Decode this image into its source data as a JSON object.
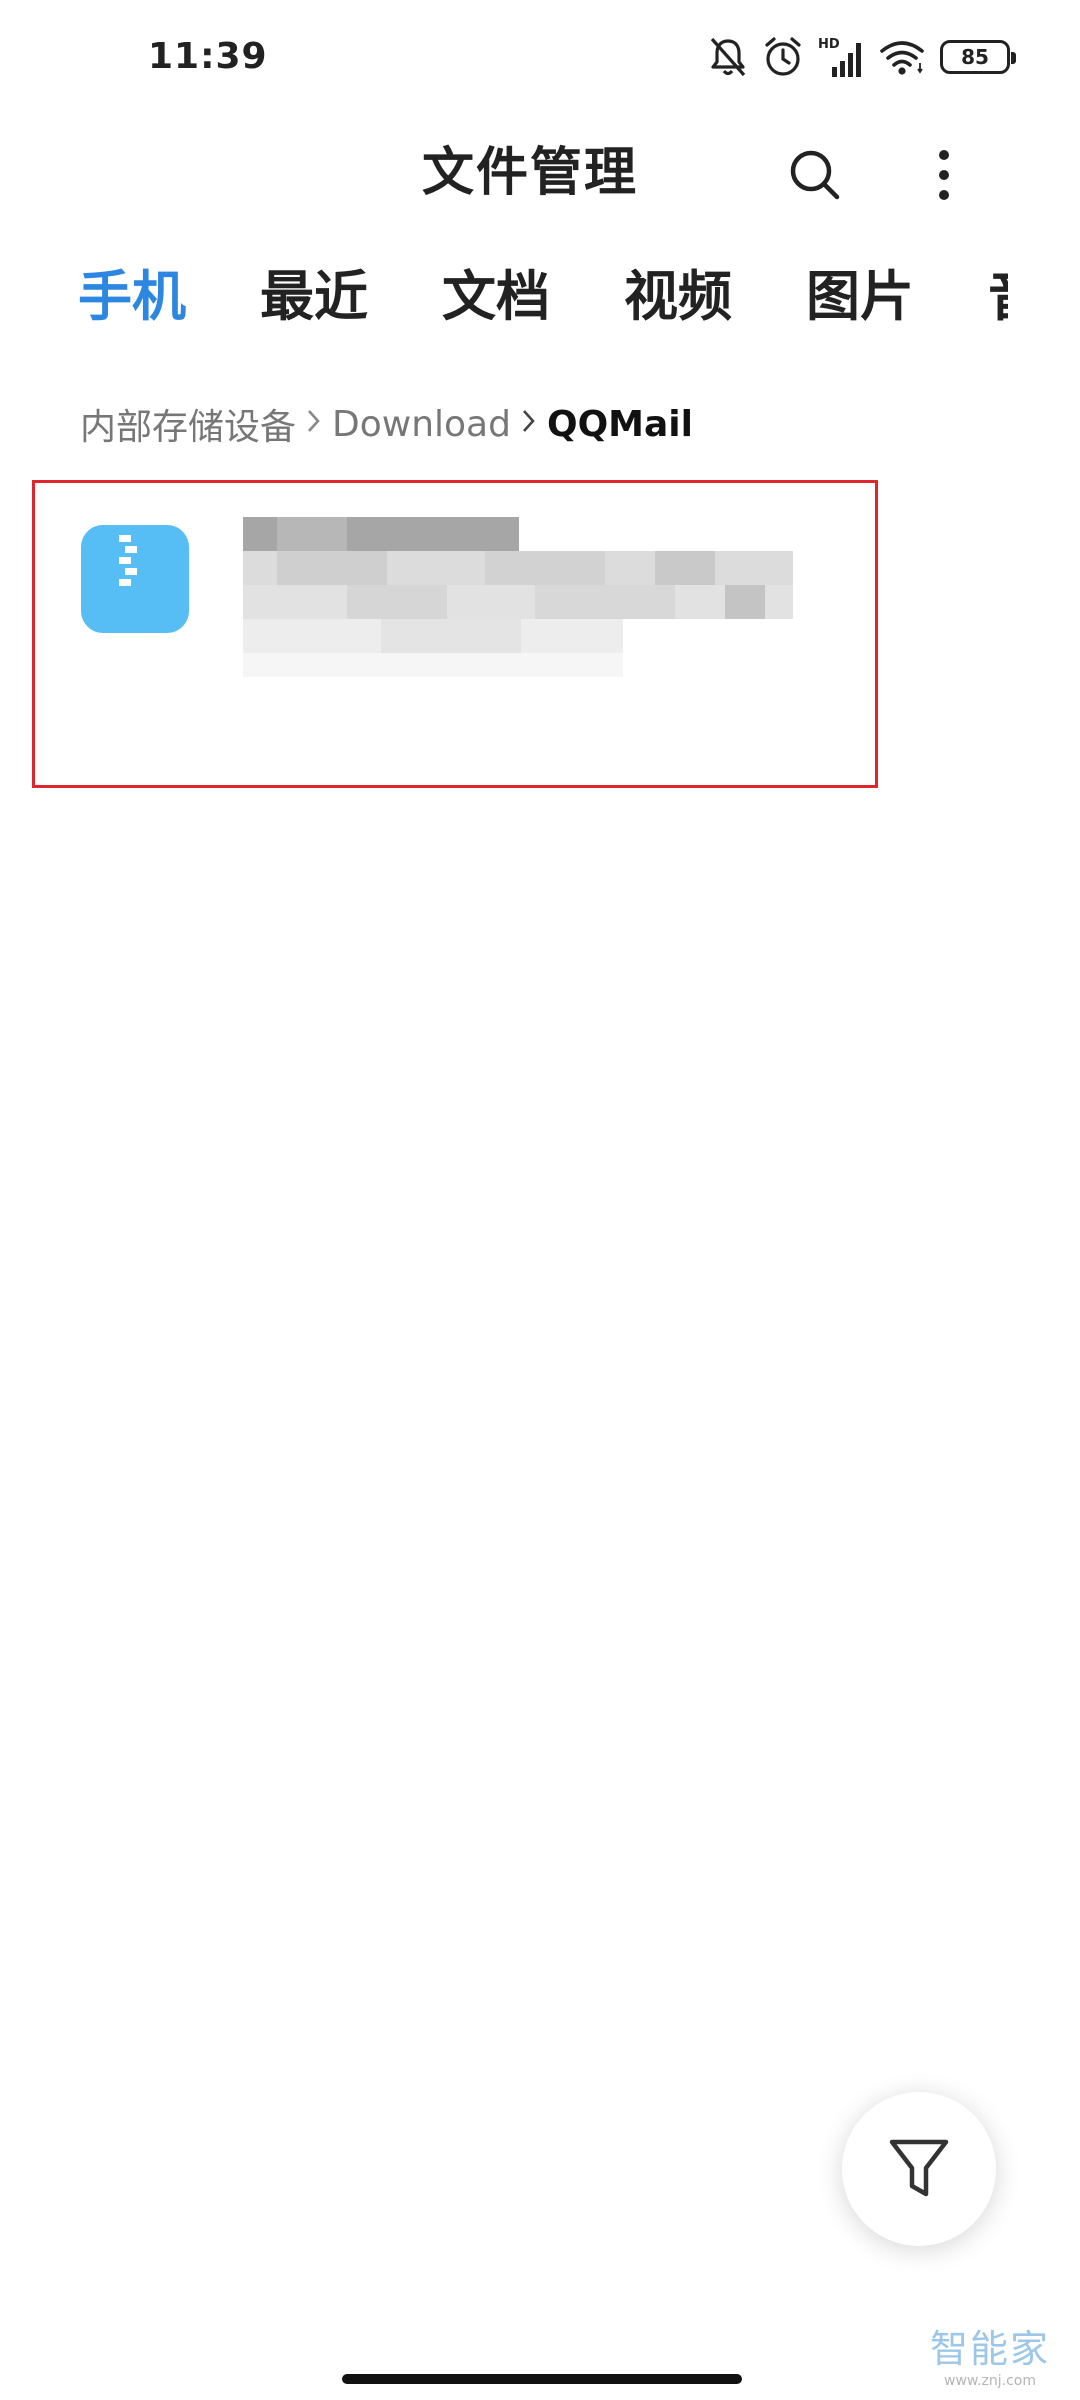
{
  "status_bar": {
    "time": "11:39",
    "battery": "85",
    "network_badge": "HD",
    "icons": [
      "bell-off-icon",
      "alarm-icon",
      "signal-icon",
      "wifi-icon",
      "battery-icon"
    ]
  },
  "header": {
    "title": "文件管理",
    "icons": [
      "search-icon",
      "more-vert-icon"
    ]
  },
  "tabs": [
    {
      "label": "手机",
      "active": true
    },
    {
      "label": "最近",
      "active": false
    },
    {
      "label": "文档",
      "active": false
    },
    {
      "label": "视频",
      "active": false
    },
    {
      "label": "图片",
      "active": false
    },
    {
      "label": "音",
      "active": false
    }
  ],
  "breadcrumb": [
    {
      "label": "内部存储设备"
    },
    {
      "label": "Download"
    },
    {
      "label": "QQMail",
      "current": true
    }
  ],
  "file_list": {
    "items": [
      {
        "icon": "zip-file-icon",
        "icon_color": "#56bdf5",
        "name_redacted": true
      }
    ]
  },
  "fab": {
    "icon": "filter-icon"
  },
  "watermark": {
    "text": "智能家",
    "url": "www.znj.com"
  },
  "colors": {
    "accent": "#2d87e0",
    "highlight_border": "#e0262d",
    "file_icon": "#56bdf5"
  }
}
